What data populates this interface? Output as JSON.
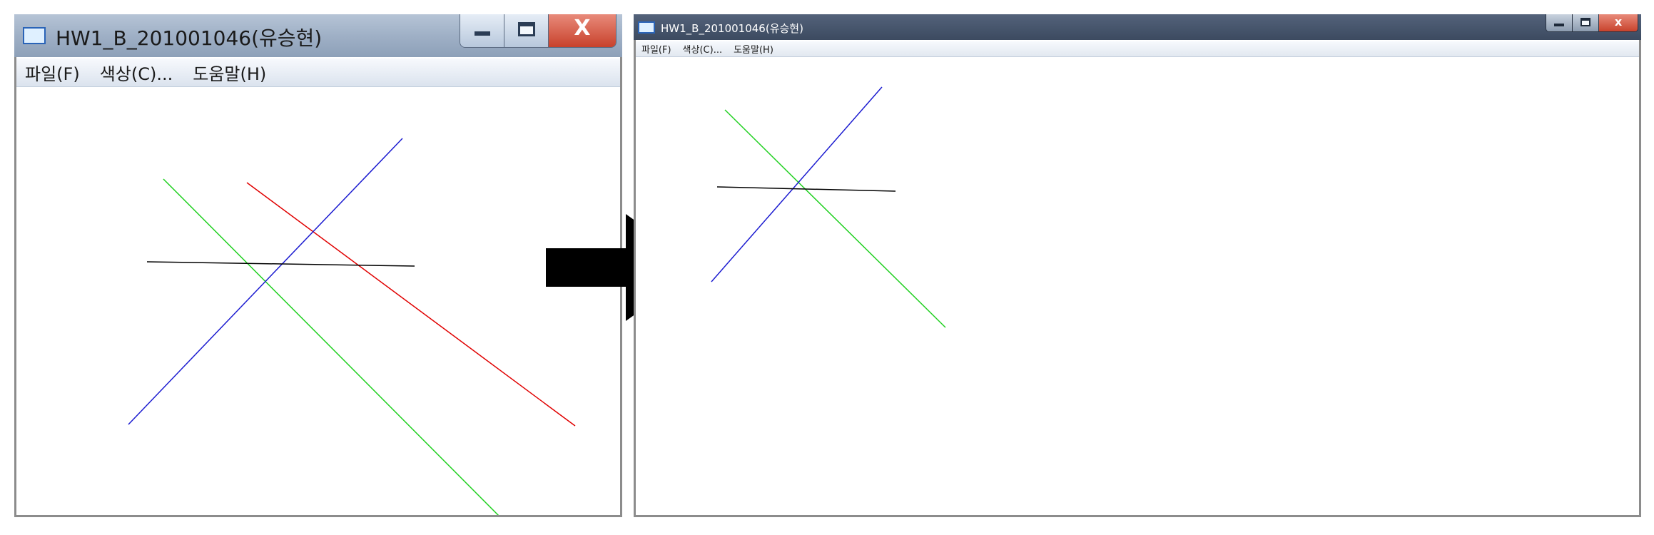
{
  "colors": {
    "line_black": "#000000",
    "line_red": "#e00000",
    "line_green": "#20d020",
    "line_blue": "#1a1ad0",
    "arrow": "#000000"
  },
  "left_window": {
    "title": "HW1_B_201001046(유승현)",
    "menu": [
      "파일(F)",
      "색상(C)...",
      "도움말(H)"
    ],
    "controls": {
      "minimize_icon": "minimize-icon",
      "maximize_icon": "maximize-icon",
      "close_glyph": "X"
    }
  },
  "right_window": {
    "title": "HW1_B_201001046(유승현)",
    "menu": [
      "파일(F)",
      "색상(C)...",
      "도움말(H)"
    ],
    "controls": {
      "minimize_icon": "minimize-icon",
      "maximize_icon": "maximize-icon",
      "close_glyph": "x"
    }
  },
  "transition_icon": "right-arrow-icon"
}
